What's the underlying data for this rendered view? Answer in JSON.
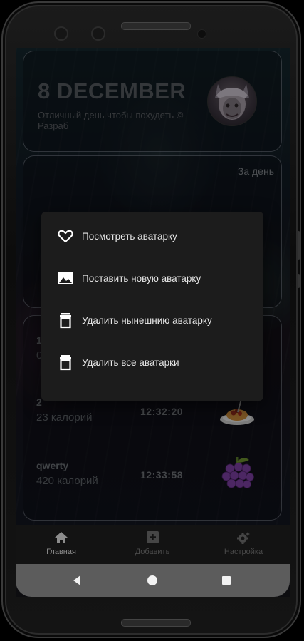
{
  "header": {
    "date": "8 DECEMBER",
    "subtitle": "Отличный день чтобы похудеть © Разраб"
  },
  "stats": {
    "period_label": "За день"
  },
  "food_list": [
    {
      "name": "1",
      "calories": "0",
      "time": "",
      "icon": "food-icon"
    },
    {
      "name": "2",
      "calories": "23 калорий",
      "time": "12:32:20",
      "icon": "spaghetti-icon"
    },
    {
      "name": "qwerty",
      "calories": "420 калорий",
      "time": "12:33:58",
      "icon": "grapes-icon"
    }
  ],
  "context_menu": {
    "items": [
      {
        "label": "Посмотреть аватарку",
        "icon": "heart-icon"
      },
      {
        "label": "Поставить новую аватарку",
        "icon": "image-icon"
      },
      {
        "label": "Удалить нынешнию аватарку",
        "icon": "trash-icon"
      },
      {
        "label": "Удалить все аватарки",
        "icon": "trash-icon"
      }
    ]
  },
  "bottom_nav": {
    "items": [
      {
        "label": "Главная",
        "icon": "home-icon",
        "active": true
      },
      {
        "label": "Добавить",
        "icon": "add-box-icon",
        "active": false
      },
      {
        "label": "Настройка",
        "icon": "settings-icon",
        "active": false
      }
    ]
  },
  "system_nav": {
    "buttons": [
      "back-icon",
      "home-circle-icon",
      "recents-icon"
    ]
  },
  "colors": {
    "menu_bg": "#1c1c1c",
    "menu_text": "#e6e6e6",
    "nav_bg": "#131313",
    "system_bar": "#5c5c5c"
  }
}
